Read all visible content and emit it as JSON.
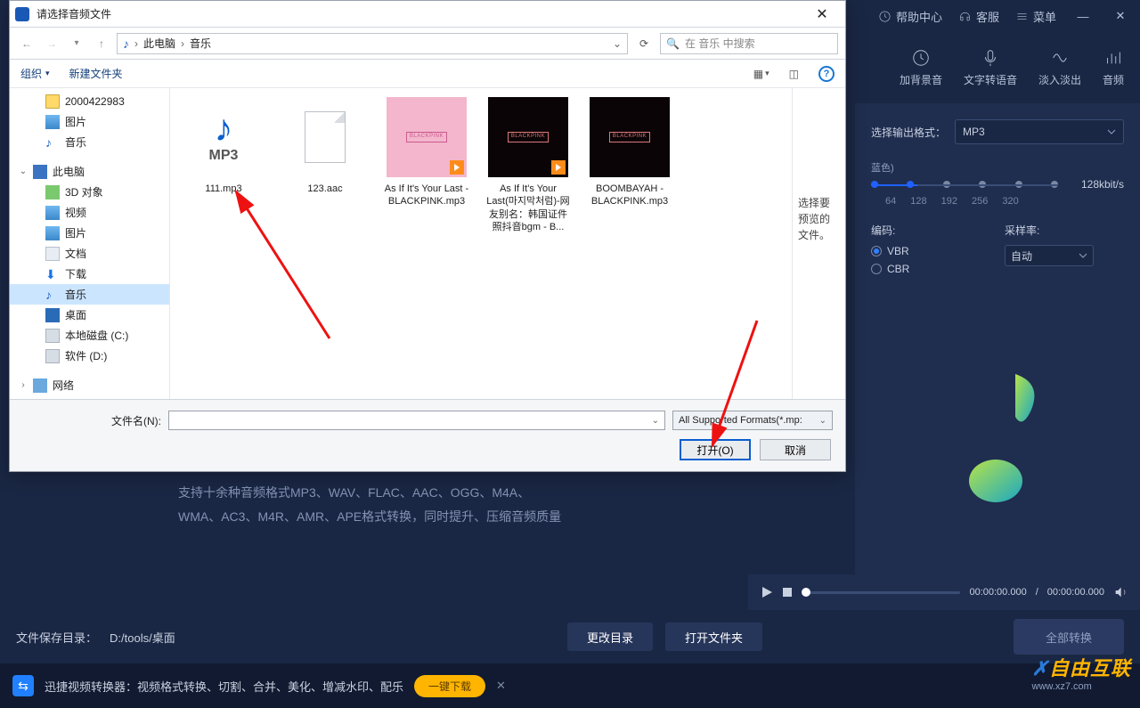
{
  "titlebar": {
    "help_center": "帮助中心",
    "customer_service": "客服",
    "menu": "菜单"
  },
  "toolbar": {
    "add_bg": "加背景音",
    "tts": "文字转语音",
    "fade": "淡入淡出",
    "audio": "音频"
  },
  "right_panel": {
    "output_label": "选择输出格式：",
    "output_value": "MP3",
    "quality_hint": "蓝色)",
    "bitrate_value": "128kbit/s",
    "bitrate_labels": [
      "64",
      "128",
      "192",
      "256",
      "320"
    ],
    "encoding_label": "编码:",
    "sample_rate_label": "采样率:",
    "enc_vbr": "VBR",
    "enc_cbr": "CBR",
    "sample_value": "自动"
  },
  "player": {
    "time_current": "00:00:00.000",
    "time_total": "00:00:00.000"
  },
  "desc": {
    "line1": "支持十余种音频格式MP3、WAV、FLAC、AAC、OGG、M4A、",
    "line2": "WMA、AC3、M4R、AMR、APE格式转换，同时提升、压缩音频质量"
  },
  "footer": {
    "save_label": "文件保存目录：",
    "save_path": "D:/tools/桌面",
    "change_dir": "更改目录",
    "open_folder": "打开文件夹",
    "convert_all": "全部转换"
  },
  "ad": {
    "text": "迅捷视频转换器：视频格式转换、切割、合并、美化、增减水印、配乐",
    "button": "一键下载"
  },
  "watermark": {
    "brand": "自由互联",
    "url": "www.xz7.com"
  },
  "dialog": {
    "title": "请选择音频文件",
    "breadcrumb": [
      "此电脑",
      "音乐"
    ],
    "search_placeholder": "在 音乐 中搜索",
    "organize": "组织",
    "new_folder": "新建文件夹",
    "tree": {
      "n_2000422983": "2000422983",
      "n_pictures": "图片",
      "n_music_top": "音乐",
      "n_this_pc": "此电脑",
      "n_3d": "3D 对象",
      "n_videos": "视频",
      "n_pictures2": "图片",
      "n_docs": "文档",
      "n_downloads": "下载",
      "n_music": "音乐",
      "n_desktop": "桌面",
      "n_diskc": "本地磁盘 (C:)",
      "n_diskd": "软件 (D:)",
      "n_network": "网络"
    },
    "files": {
      "f1": "111.mp3",
      "f1_badge": "MP3",
      "f2": "123.aac",
      "f3": "As If It's Your Last - BLACKPINK.mp3",
      "f4": "As If It's Your Last(마지막처럼)-网友别名：韩国证件照抖音bgm - B...",
      "f5": "BOOMBAYAH - BLACKPINK.mp3",
      "bp_label": "BLACKPINK"
    },
    "preview_hint": "选择要预览的文件。",
    "filename_label": "文件名(N):",
    "filter": "All Supported Formats(*.mp:",
    "btn_open": "打开(O)",
    "btn_cancel": "取消"
  }
}
